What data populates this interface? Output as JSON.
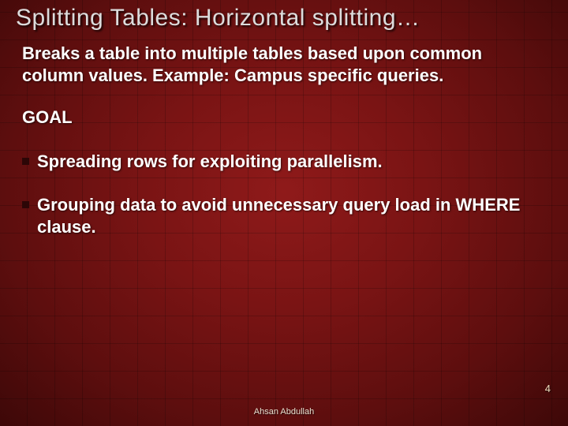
{
  "title": "Splitting Tables: Horizontal splitting…",
  "intro": "Breaks a table into multiple tables based upon common column values. Example: Campus specific queries.",
  "goal_label": "GOAL",
  "bullets": [
    "Spreading rows for exploiting parallelism.",
    "Grouping data to avoid unnecessary query load in WHERE clause."
  ],
  "page_number": "4",
  "author": "Ahsan Abdullah"
}
